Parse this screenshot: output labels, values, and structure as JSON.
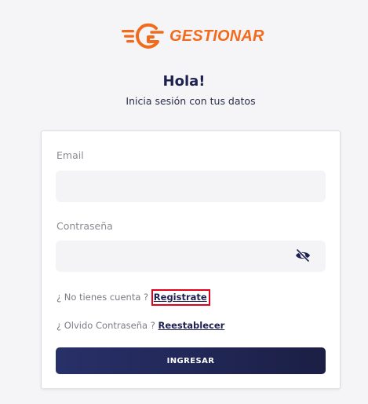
{
  "brand": {
    "name": "GESTIONAR",
    "color": "#f26b1d"
  },
  "header": {
    "greeting": "Hola!",
    "subtitle": "Inicia sesión con tus datos"
  },
  "form": {
    "email_label": "Email",
    "email_value": "",
    "password_label": "Contraseña",
    "password_value": "",
    "password_toggle_icon": "eye-off-icon",
    "no_account_text": "¿ No tienes cuenta ? ",
    "register_link": "Registrate",
    "forgot_text": "¿ Olvido Contraseña ? ",
    "reset_link": "Reestablecer",
    "submit_label": "INGRESAR"
  },
  "colors": {
    "accent": "#f26b1d",
    "primary": "#1e2150",
    "highlight_border": "#e5001c"
  }
}
